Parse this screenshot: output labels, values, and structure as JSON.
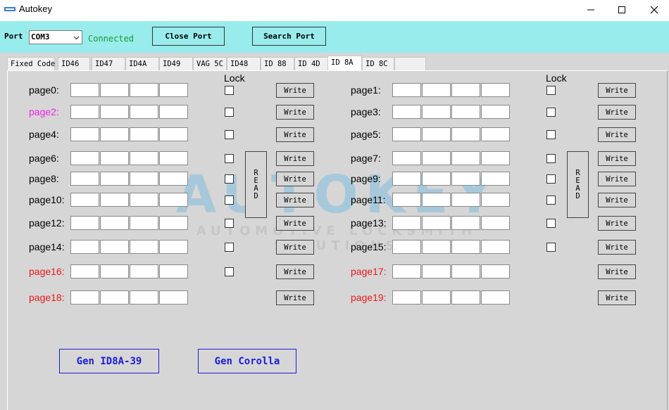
{
  "window": {
    "title": "Autokey",
    "icon": "autokey-logo-icon",
    "controls": [
      "minimize-icon",
      "maximize-icon",
      "close-icon"
    ]
  },
  "port_bar": {
    "port_label": "Port",
    "port_value": "COM3",
    "status": "Connected",
    "close_port_label": "Close Port",
    "search_port_label": "Search Port"
  },
  "tabs": [
    {
      "label": "Fixed Code",
      "active": false
    },
    {
      "label": "ID46",
      "active": false
    },
    {
      "label": "ID47",
      "active": false
    },
    {
      "label": "ID4A",
      "active": false
    },
    {
      "label": "ID49",
      "active": false
    },
    {
      "label": "VAG 5C",
      "active": false
    },
    {
      "label": "ID48",
      "active": false
    },
    {
      "label": "ID 88",
      "active": false
    },
    {
      "label": "ID 4D",
      "active": false
    },
    {
      "label": "ID 8A",
      "active": true
    },
    {
      "label": "ID 8C",
      "active": false
    }
  ],
  "lock_label": "Lock",
  "write_label": "Write",
  "read_label": [
    "R",
    "E",
    "A",
    "D"
  ],
  "pages_left": [
    {
      "label": "page0:",
      "color": "#000000"
    },
    {
      "label": "page2:",
      "color": "#f020f0"
    },
    {
      "label": "page4:",
      "color": "#000000"
    },
    {
      "label": "page6:",
      "color": "#000000"
    },
    {
      "label": "page8:",
      "color": "#000000"
    },
    {
      "label": "page10:",
      "color": "#000000"
    },
    {
      "label": "page12:",
      "color": "#000000"
    },
    {
      "label": "page14:",
      "color": "#000000"
    },
    {
      "label": "page16:",
      "color": "#e81919"
    },
    {
      "label": "page18:",
      "color": "#e81919"
    }
  ],
  "pages_right": [
    {
      "label": "page1:",
      "color": "#000000"
    },
    {
      "label": "page3:",
      "color": "#000000"
    },
    {
      "label": "page5:",
      "color": "#000000"
    },
    {
      "label": "page7:",
      "color": "#000000"
    },
    {
      "label": "page9:",
      "color": "#000000"
    },
    {
      "label": "page11:",
      "color": "#000000"
    },
    {
      "label": "page13:",
      "color": "#000000"
    },
    {
      "label": "page15:",
      "color": "#000000"
    },
    {
      "label": "page17:",
      "color": "#e81919"
    },
    {
      "label": "page19:",
      "color": "#e81919"
    }
  ],
  "watermark": {
    "main": "AUTOKEY",
    "sub": "AUTOMOTIVE LOCKSMITH SOLUTIONS"
  },
  "gen_buttons": {
    "gen_id8a": "Gen ID8A-39",
    "gen_corolla": "Gen Corolla"
  },
  "colors": {
    "port_bar_bg": "#98ecec",
    "status_green": "#1c9a2f",
    "gen_button_blue": "#1c1cd8"
  }
}
